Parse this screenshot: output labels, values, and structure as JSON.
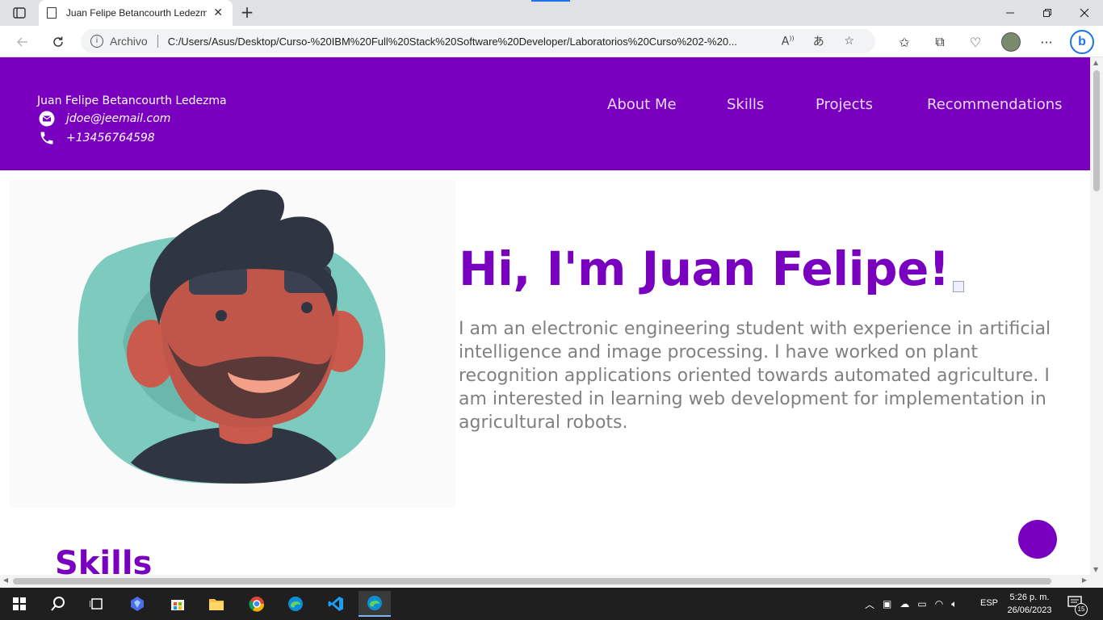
{
  "browser": {
    "tab_title": "Juan Felipe Betancourth Ledezma",
    "tab_close": "✕",
    "new_tab": "+",
    "address_prefix": "Archivo",
    "url": "C:/Users/Asus/Desktop/Curso-%20IBM%20Full%20Stack%20Software%20Developer/Laboratorios%20Curso%202-%20..."
  },
  "site": {
    "name": "Juan Felipe Betancourth Ledezma",
    "email": "jdoe@jeemail.com",
    "phone": "+13456764598",
    "nav": [
      "About Me",
      "Skills",
      "Projects",
      "Recommendations"
    ]
  },
  "hero": {
    "title": "Hi, I'm Juan Felipe!",
    "description": "I am an electronic engineering student with experience in artificial intelligence and image processing. I have worked on plant recognition applications oriented towards automated agriculture. I am interested in learning web development for implementation in agricultural robots."
  },
  "skills": {
    "title": "Skills"
  },
  "taskbar": {
    "language": "ESP",
    "time": "5:26 p. m.",
    "date": "26/06/2023",
    "notifications": "15"
  },
  "colors": {
    "brand": "#7a00c0",
    "text_gray": "#808080"
  }
}
